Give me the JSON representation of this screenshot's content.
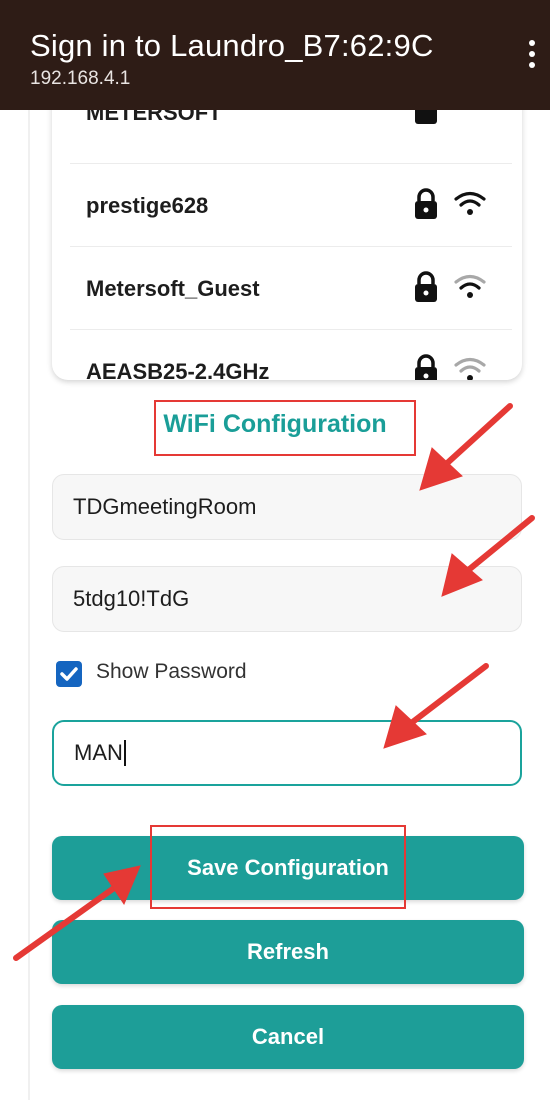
{
  "header": {
    "title": "Sign in to Laundro_B7:62:9C",
    "url": "192.168.4.1"
  },
  "networks": [
    {
      "name": "METERSOFT"
    },
    {
      "name": "prestige628"
    },
    {
      "name": "Metersoft_Guest"
    },
    {
      "name": "AEASB25-2.4GHz"
    }
  ],
  "form": {
    "title": "WiFi Configuration",
    "ssid_value": "TDGmeetingRoom",
    "password_value": "5tdg10!TdG",
    "show_password_label": "Show Password",
    "show_password_checked": true,
    "device_value": "MAN"
  },
  "buttons": {
    "save": "Save Configuration",
    "refresh": "Refresh",
    "cancel": "Cancel"
  },
  "colors": {
    "header_bg": "#2e1c16",
    "accent": "#1d9e98",
    "highlight": "#e53935",
    "checkbox": "#1565c0"
  }
}
